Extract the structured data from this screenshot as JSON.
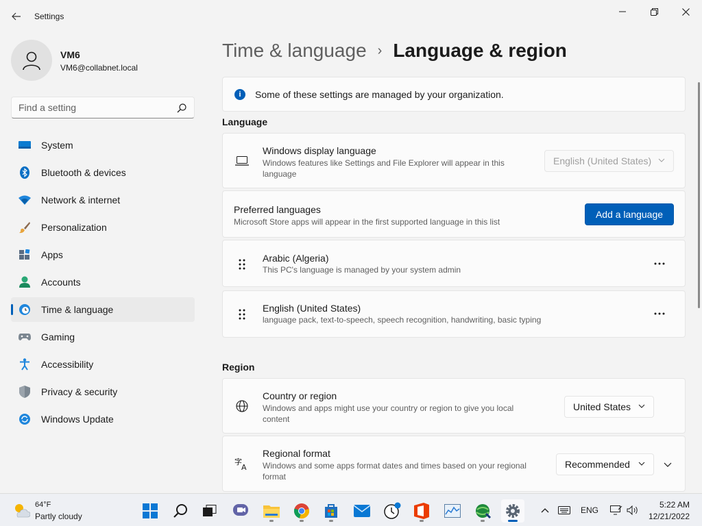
{
  "window": {
    "app_title": "Settings",
    "back_icon": "back-arrow-icon",
    "minimize_icon": "minimize-icon",
    "maximize_icon": "restore-icon",
    "close_icon": "close-icon"
  },
  "profile": {
    "name": "VM6",
    "email": "VM6@collabnet.local"
  },
  "search": {
    "placeholder": "Find a setting"
  },
  "sidebar": {
    "items": [
      {
        "label": "System",
        "icon": "system-icon"
      },
      {
        "label": "Bluetooth & devices",
        "icon": "bluetooth-icon"
      },
      {
        "label": "Network & internet",
        "icon": "wifi-icon"
      },
      {
        "label": "Personalization",
        "icon": "brush-icon"
      },
      {
        "label": "Apps",
        "icon": "apps-icon"
      },
      {
        "label": "Accounts",
        "icon": "accounts-icon"
      },
      {
        "label": "Time & language",
        "icon": "time-language-icon",
        "active": true
      },
      {
        "label": "Gaming",
        "icon": "gaming-icon"
      },
      {
        "label": "Accessibility",
        "icon": "accessibility-icon"
      },
      {
        "label": "Privacy & security",
        "icon": "shield-icon"
      },
      {
        "label": "Windows Update",
        "icon": "windows-update-icon"
      }
    ]
  },
  "breadcrumb": {
    "parent": "Time & language",
    "separator": "›",
    "current": "Language & region"
  },
  "info_banner": {
    "text": "Some of these settings are managed by your organization."
  },
  "language": {
    "section_title": "Language",
    "display_language": {
      "title": "Windows display language",
      "description": "Windows features like Settings and File Explorer will appear in this language",
      "value": "English (United States)",
      "disabled": true
    },
    "preferred": {
      "title": "Preferred languages",
      "description": "Microsoft Store apps will appear in the first supported language in this list",
      "add_button": "Add a language"
    },
    "languages": [
      {
        "name": "Arabic (Algeria)",
        "detail": "This PC's language is managed by your system admin"
      },
      {
        "name": "English (United States)",
        "detail": "language pack, text-to-speech, speech recognition, handwriting, basic typing"
      }
    ],
    "more_label": "..."
  },
  "region": {
    "section_title": "Region",
    "country": {
      "title": "Country or region",
      "description": "Windows and apps might use your country or region to give you local content",
      "value": "United States"
    },
    "format": {
      "title": "Regional format",
      "description": "Windows and some apps format dates and times based on your regional format",
      "value": "Recommended"
    }
  },
  "taskbar": {
    "weather": {
      "temp": "64°F",
      "condition": "Partly cloudy"
    },
    "apps": [
      "start-icon",
      "search-icon",
      "task-view-icon",
      "chat-icon",
      "file-explorer-icon",
      "chrome-icon",
      "store-icon",
      "mail-icon",
      "clock-app-icon",
      "office-icon",
      "perf-monitor-icon",
      "network-globe-icon",
      "settings-gear-icon"
    ],
    "tray": {
      "language": "ENG"
    },
    "clock": {
      "time": "5:22 AM",
      "date": "12/21/2022"
    }
  },
  "colors": {
    "accent": "#005fb8",
    "background": "#f3f3f3",
    "card": "#fbfbfb"
  }
}
